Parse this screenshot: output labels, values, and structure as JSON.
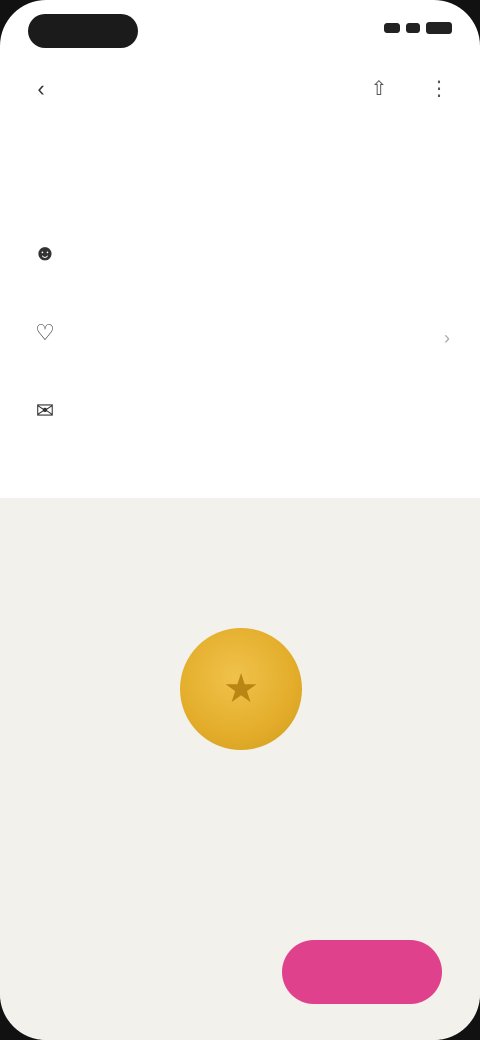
{
  "status_bar": {
    "time": ""
  },
  "header": {
    "back_icon": "back-arrow-icon",
    "icons": [
      "share-icon",
      "more-icon"
    ]
  },
  "features": {
    "title": "",
    "items": [
      {
        "icon": "user-icon",
        "title": "",
        "description": ""
      },
      {
        "icon": "heart-icon",
        "title": "",
        "description": ""
      },
      {
        "icon": "chat-icon",
        "title": "",
        "description": ""
      }
    ]
  },
  "promo": {
    "coin_icon": "coin-icon",
    "title": "",
    "description": "",
    "price_label": "",
    "price_sub": "",
    "cta_label": ""
  },
  "colors": {
    "accent": "#e0418c",
    "coin": "#e8b133",
    "promo_bg": "#f3f1eb"
  }
}
